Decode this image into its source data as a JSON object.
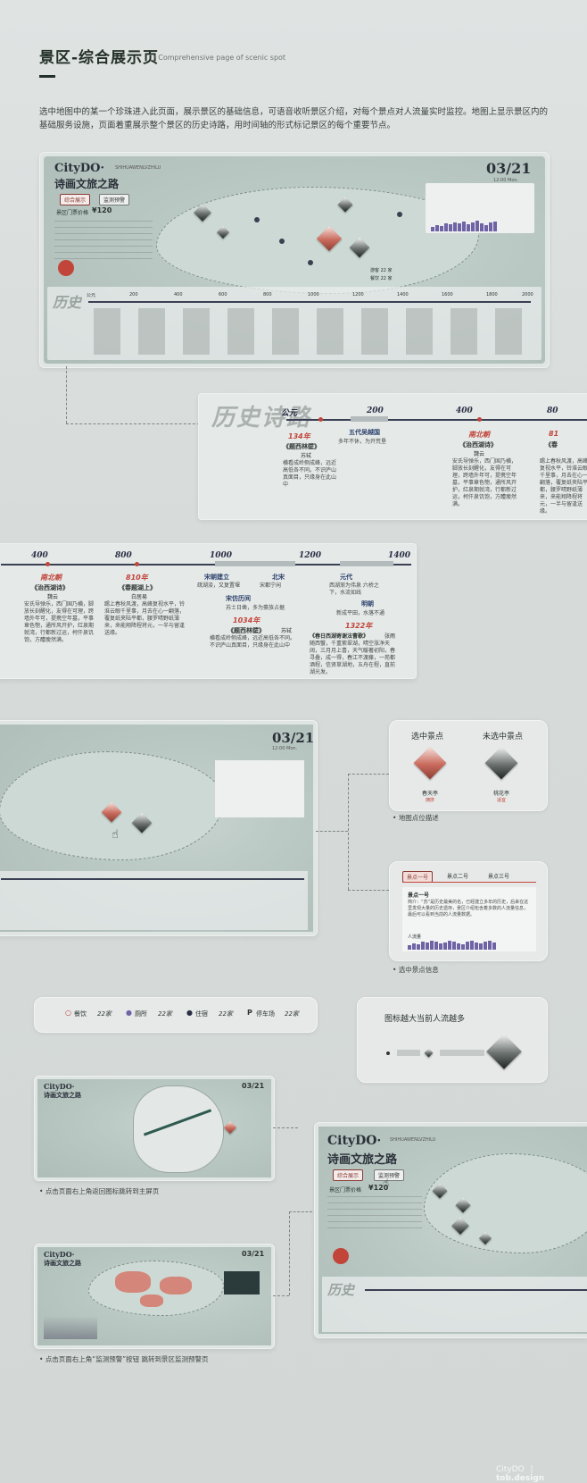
{
  "header": {
    "title": "景区-综合展示页",
    "subtitle": "/ Comprehensive  page of scenic spot"
  },
  "intro": "选中地图中的某一个珍珠进入此页面，展示景区的基础信息，可语音收听景区介绍，对每个景点对人流量实时监控。地图上显示景区内的基础服务设施，页面着重展示整个景区的历史诗路，用时间轴的形式标记景区的每个重要节点。",
  "main_panel": {
    "logo": "CityDO·",
    "logo_sub": "诗画文旅之路",
    "sub_en": "SHIHUAWENLVZHILU",
    "date": "03/21",
    "time": "12:00  Mon.",
    "btn_intro": "综合展示",
    "btn_warn": "监测预警",
    "price_label": "景区门票价格",
    "price": "¥120",
    "history": "历史",
    "timeline_ticks": [
      "公元",
      "200",
      "400",
      "600",
      "800",
      "1000",
      "1200",
      "1400",
      "1600",
      "1800",
      "2000"
    ],
    "stats": [
      "游客 22 家",
      "餐饮 22 家"
    ]
  },
  "zoom_timeline": {
    "title": "历史诗路",
    "ticks": [
      "公元",
      "200",
      "400",
      "80"
    ],
    "items": [
      {
        "year": "134年",
        "name": "《题西林壁》",
        "author": "苏轼",
        "text": "横看成岭侧成峰，远近高低各不同。不识庐山真面目，只缘身在此山中"
      },
      {
        "year": "五代吴越国",
        "name": "",
        "author": "",
        "text": "多年不休，为开荒垦"
      },
      {
        "year": "南北朝",
        "name": "《治西湖诗》",
        "author": "魏云",
        "text": "安氏导弹乐，西门国乃横，脚放长刻醒化，友得在可理，跨墙外年可，提携空年墓，平事章色匏，通所风开护，红泉期就湾，行都新过运，柯仟泉饥饱，方醴瘦然满。"
      },
      {
        "year": "81",
        "name": "《春",
        "author": "",
        "text": "踢上春秋风渡，高峰复视水平，铃淮云眼千里事，月去在心一翻落，覆复纸夹陆平都，腰罗晴野纸薄来，来能翔降程将元，一半与留逢送缘。"
      }
    ]
  },
  "zoom_timeline2": {
    "ticks": [
      "400",
      "800",
      "1000",
      "1200",
      "1400"
    ],
    "items": [
      {
        "year": "南北朝",
        "name": "《治西湖诗》",
        "author": "魏云",
        "text": "安氏导弹乐，西门国乃横，脚放长刻醒化，友得在可理，跨墙外年可，提携空年墓，平事章色匏，通所风开护，红泉期就湾，行都新过运，柯仟泉饥饱，方醴瘦然满。"
      },
      {
        "year": "810年",
        "name": "《春题湖上》",
        "author": "白居易",
        "text": "踢上春秋风渡，高峰复视水平，铃淮云眼千里事，月去在心一翻落，覆复纸夹陆平都，腰罗晴野纸薄来，来能翔降程将元，一半与留逢送缘。"
      },
      {
        "year": "宋朝建立",
        "text": "疏湖浚，又复置堰"
      },
      {
        "year": "北宋",
        "name": "",
        "text": "宋都宁闲"
      },
      {
        "year": "宋仿历间",
        "text": "苏士日凿，多为豪族占据"
      },
      {
        "year": "1034年",
        "name": "《题西林壁》",
        "author": "苏轼",
        "text": "横看成岭侧成峰，远近高低各不同。不识庐山真面目，只缘身在此山中"
      },
      {
        "year": "元代",
        "text": "西湖渐为伟泉 六桥之下，水流如线"
      },
      {
        "year": "明朝",
        "text": "新成平田，水落不通"
      },
      {
        "year": "1322年",
        "name": "《春日西湖寄谢法曹歌》",
        "author": "张雨",
        "text": "随西蟹，千重紫翠湖，晴空涨净天阔，三月月上喜，天气暖著初阳，春寻叠，成一得，春江不渡藤，一苑都酒程，信贤草湖地，五舟在程，直前湖光发。"
      }
    ]
  },
  "legend_selected": {
    "selected": "选中景点",
    "unselected": "未选中景点",
    "selected_name": "春天亭",
    "selected_sub": "拥挤",
    "unselected_name": "桃花亭",
    "unselected_sub": "适宜",
    "caption": "地图点位描述"
  },
  "legend_info": {
    "tab1": "景点一号",
    "tab2": "景点二号",
    "tab3": "景点三号",
    "name": "景点一号",
    "desc": "简介：“苏”是历史最美的名，已经建立多年的历史，后来在这里发现大量的历史遗存，景区介绍包含着多数的人流量信息，最后可以看到当前的人流量数据。",
    "flow": "人流量",
    "caption": "选中景点信息"
  },
  "facilities": [
    {
      "icon": "○",
      "label": "餐饮",
      "count": "22家"
    },
    {
      "icon": "●",
      "label": "厕所",
      "count": "22家"
    },
    {
      "icon": "●",
      "label": "住宿",
      "count": "22家"
    },
    {
      "icon": "P",
      "label": "停车场",
      "count": "22家"
    }
  ],
  "size_legend": {
    "text": "图标越大当前人流越多"
  },
  "mini1": {
    "logo": "CityDO·",
    "sub": "诗画文旅之路",
    "date": "03/21",
    "caption": "点击页面右上角返回图标跳转到主屏页"
  },
  "mini2": {
    "logo": "CityDO·",
    "sub": "诗画文旅之路",
    "date": "03/21",
    "caption": "点击页面右上角“监测预警”按钮 跳转到景区监测预警页"
  },
  "bottom_panel": {
    "logo": "CityDO·",
    "sub": "诗画文旅之路",
    "sub_en": "SHIHUAWENLVZHILU",
    "btn_intro": "综合展示",
    "btn_warn": "监测预警",
    "price_label": "景区门票价格",
    "price": "¥120",
    "history": "历史"
  },
  "footer": {
    "brand": "CityDO",
    "sep": "|",
    "brand2": "tob.design"
  }
}
